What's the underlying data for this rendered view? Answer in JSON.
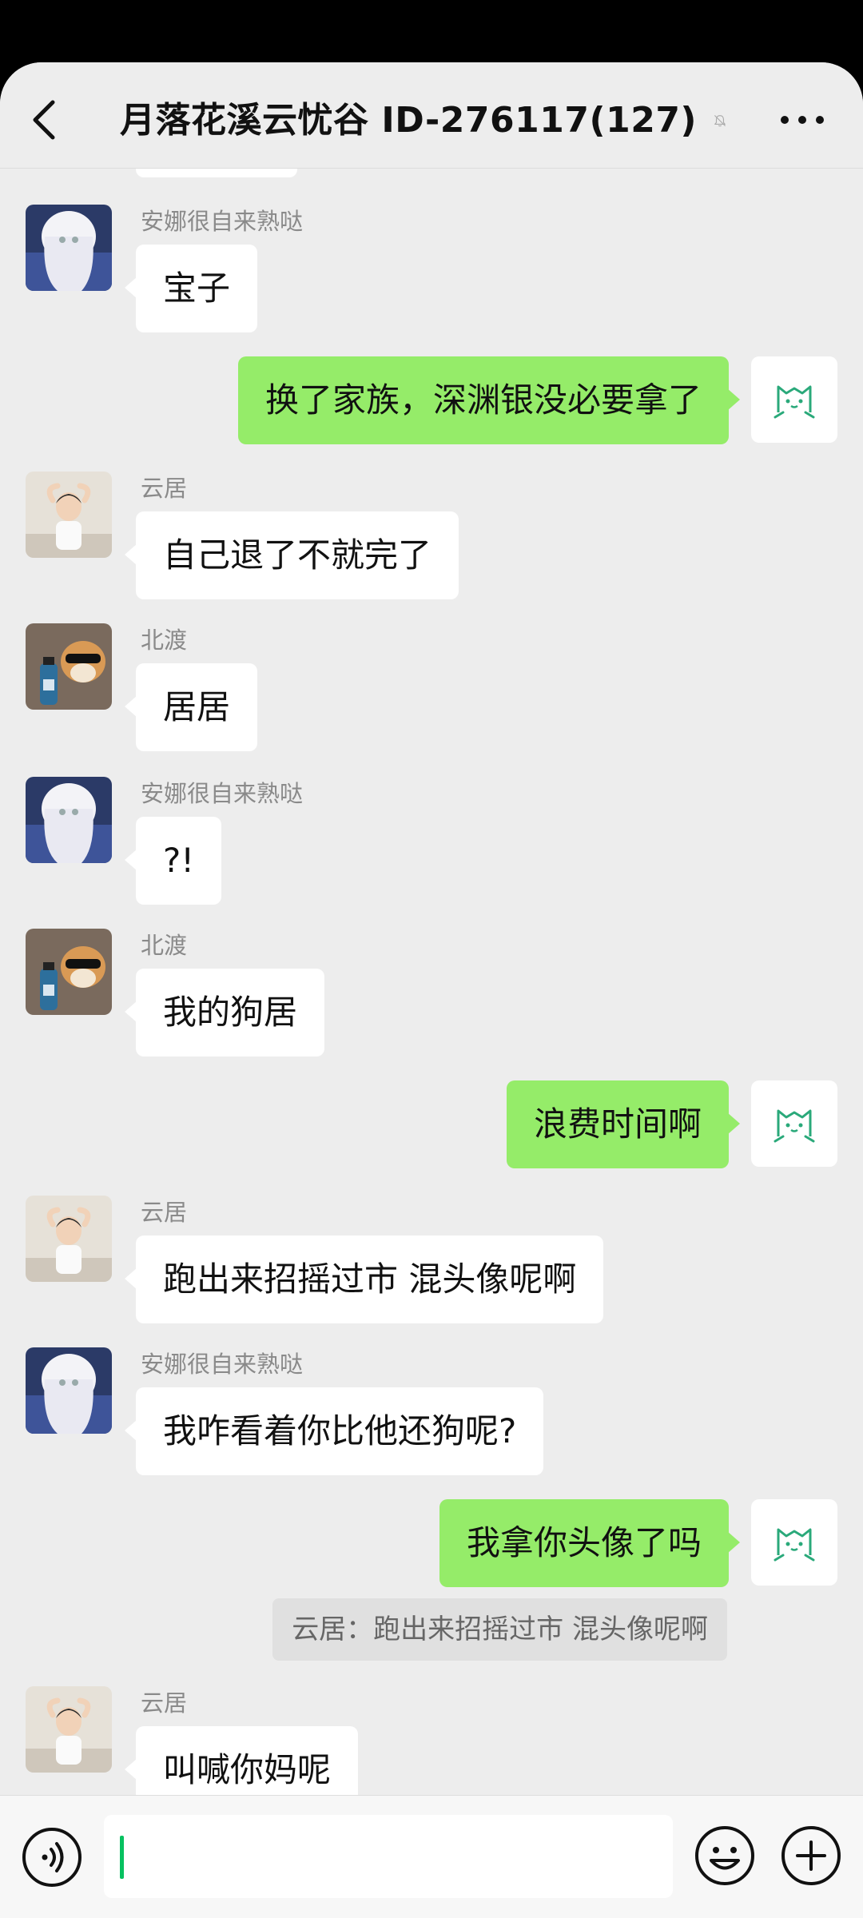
{
  "header": {
    "title": "月落花溪云忧谷 ID-276117(127)"
  },
  "messages": [
    {
      "side": "left",
      "sender": "安娜很自来熟哒",
      "avatar": "anime-girl-avatar",
      "text": "宝子"
    },
    {
      "side": "right",
      "avatar": "cat-doodle-avatar",
      "text": "换了家族，深渊银没必要拿了"
    },
    {
      "side": "left",
      "sender": "云居",
      "avatar": "toddler-photo-avatar",
      "text": "自己退了不就完了"
    },
    {
      "side": "left",
      "sender": "北渡",
      "avatar": "shiba-sunglasses-avatar",
      "text": "居居"
    },
    {
      "side": "left",
      "sender": "安娜很自来熟哒",
      "avatar": "anime-girl-avatar",
      "text": "?!"
    },
    {
      "side": "left",
      "sender": "北渡",
      "avatar": "shiba-sunglasses-avatar",
      "text": "我的狗居"
    },
    {
      "side": "right",
      "avatar": "cat-doodle-avatar",
      "text": "浪费时间啊"
    },
    {
      "side": "left",
      "sender": "云居",
      "avatar": "toddler-photo-avatar",
      "text": "跑出来招摇过市 混头像呢啊"
    },
    {
      "side": "left",
      "sender": "安娜很自来熟哒",
      "avatar": "anime-girl-avatar",
      "text": "我咋看着你比他还狗呢?"
    },
    {
      "side": "right",
      "avatar": "cat-doodle-avatar",
      "text": "我拿你头像了吗",
      "quote": "云居：跑出来招摇过市 混头像呢啊"
    },
    {
      "side": "left",
      "sender": "云居",
      "avatar": "toddler-photo-avatar",
      "text": "叫喊你妈呢"
    }
  ],
  "input": {
    "value": "",
    "placeholder": ""
  },
  "colors": {
    "background": "#ededed",
    "bubble_self": "#95ec69",
    "bubble_other": "#ffffff",
    "caret": "#07c160"
  }
}
